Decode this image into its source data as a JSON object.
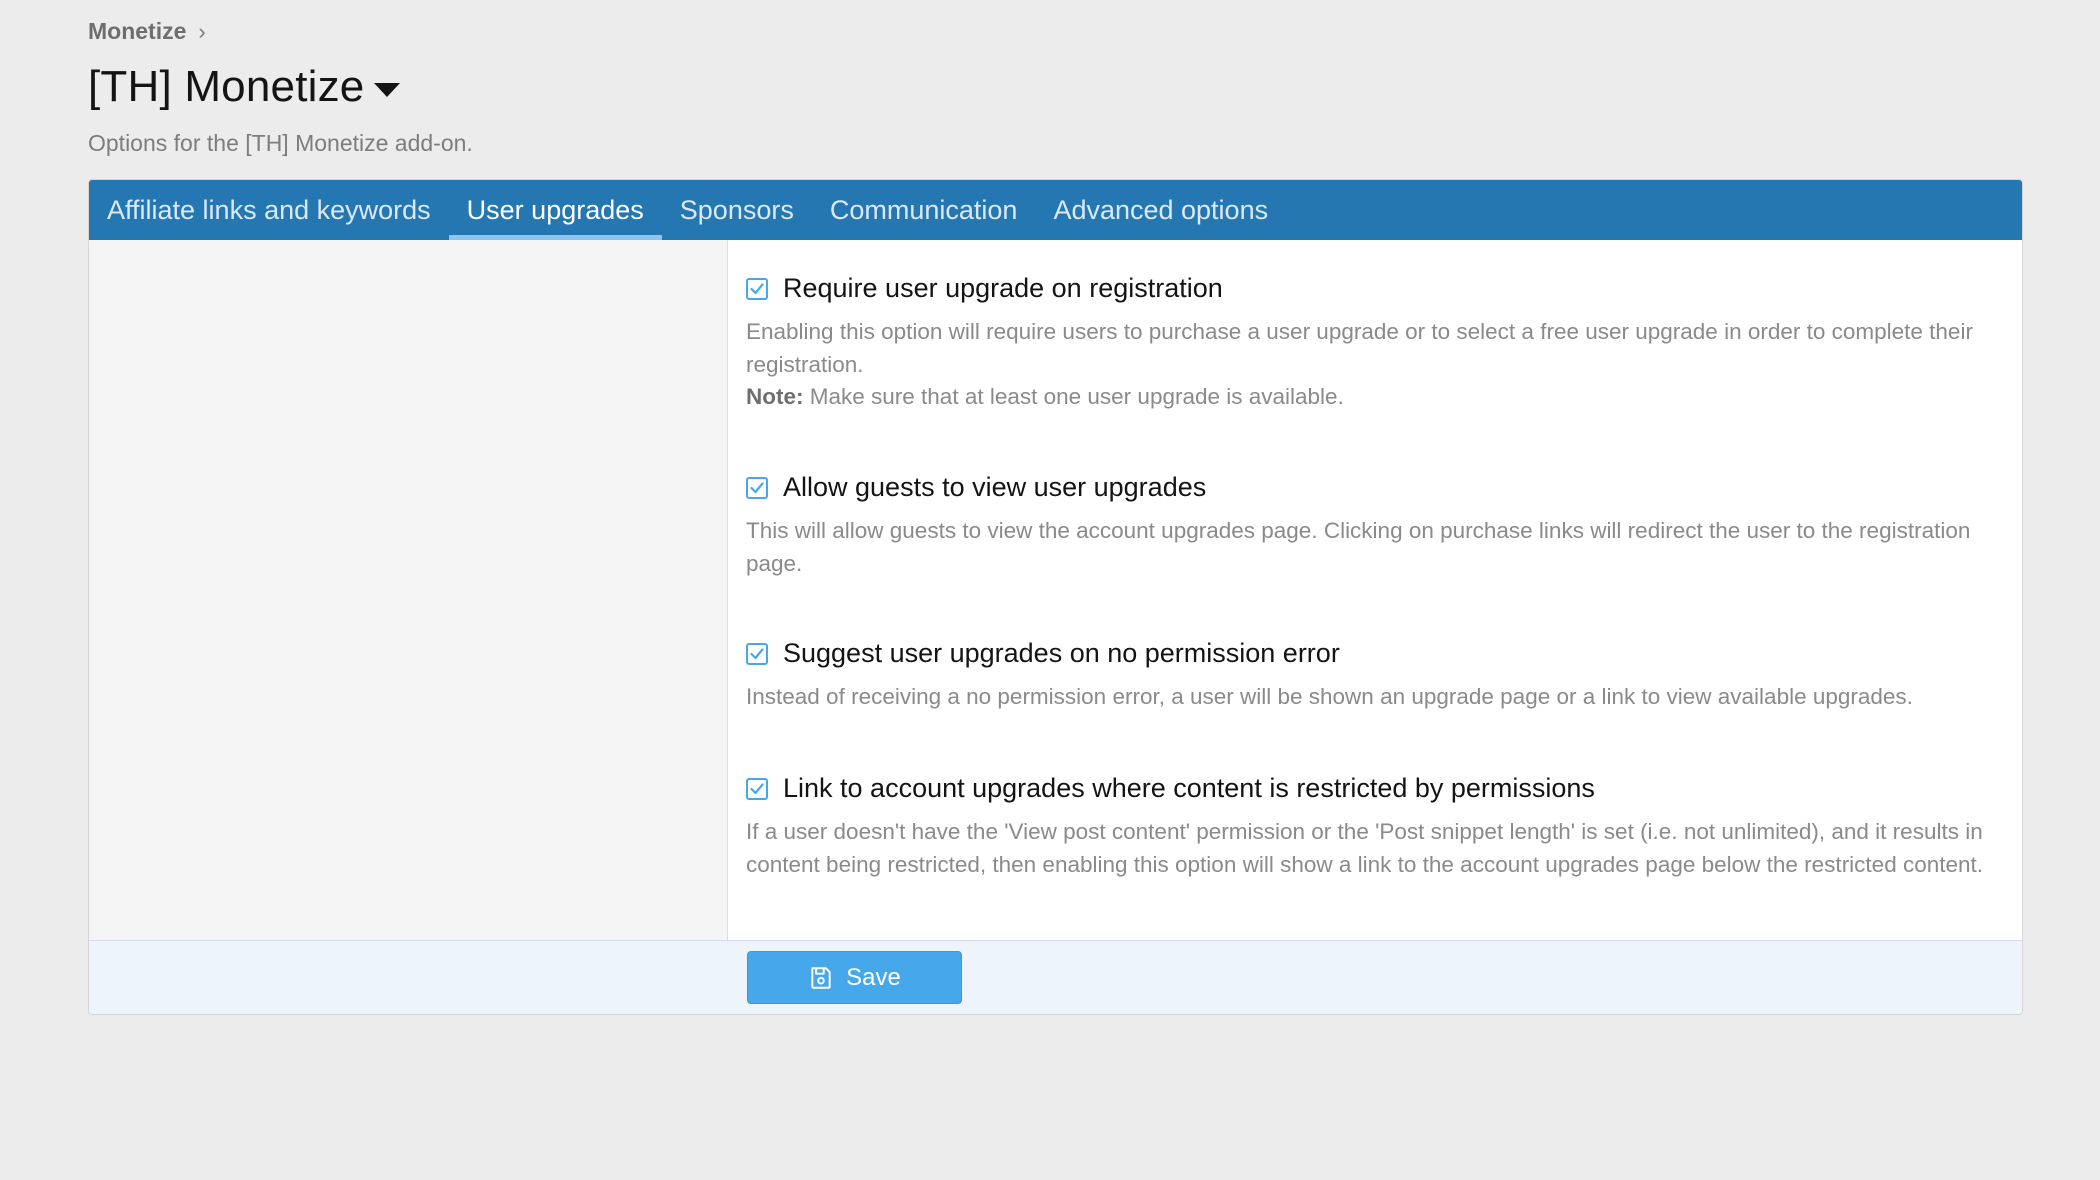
{
  "breadcrumb": {
    "item": "Monetize",
    "chevron": "›"
  },
  "page": {
    "title": "[TH] Monetize",
    "description": "Options for the [TH] Monetize add-on."
  },
  "tabs": [
    {
      "label": "Affiliate links and keywords",
      "active": false
    },
    {
      "label": "User upgrades",
      "active": true
    },
    {
      "label": "Sponsors",
      "active": false
    },
    {
      "label": "Communication",
      "active": false
    },
    {
      "label": "Advanced options",
      "active": false
    }
  ],
  "options": [
    {
      "label": "Require user upgrade on registration",
      "checked": true,
      "description": "Enabling this option will require users to purchase a user upgrade or to select a free user upgrade in order to complete their registration.",
      "note_label": "Note:",
      "note_text": " Make sure that at least one user upgrade is available."
    },
    {
      "label": "Allow guests to view user upgrades",
      "checked": true,
      "description": "This will allow guests to view the account upgrades page. Clicking on purchase links will redirect the user to the registration page."
    },
    {
      "label": "Suggest user upgrades on no permission error",
      "checked": true,
      "description": "Instead of receiving a no permission error, a user will be shown an upgrade page or a link to view available upgrades."
    },
    {
      "label": "Link to account upgrades where content is restricted by permissions",
      "checked": true,
      "description": "If a user doesn't have the 'View post content' permission or the 'Post snippet length' is set (i.e. not unlimited), and it results in content being restricted, then enabling this option will show a link to the account upgrades page below the restricted content."
    }
  ],
  "footer": {
    "save_label": "Save"
  },
  "colors": {
    "tab_bar": "#2577b1",
    "accent": "#47a7eb",
    "footer_bg": "#edf4fc"
  }
}
